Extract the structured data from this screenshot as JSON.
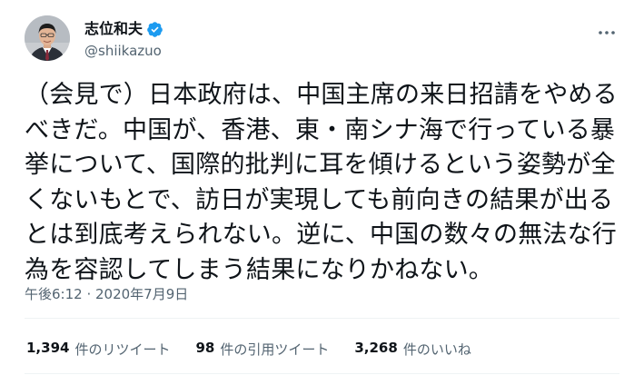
{
  "author": {
    "display_name": "志位和夫",
    "handle": "@shiikazuo",
    "verified": true,
    "verified_color": "#1d9bf0"
  },
  "tweet": {
    "text": "（会見で）日本政府は、中国主席の来日招請をやめる\nべきだ。中国が、香港、東・南シナ海で行っている暴\n挙について、国際的批判に耳を傾けるという姿勢が全\nくないもとで、訪日が実現しても前向きの結果が出る\nとは到底考えられない。逆に、中国の数々の無法な行\n為を容認してしまう結果になりかねない。",
    "timestamp": "午後6:12 · 2020年7月9日"
  },
  "stats": [
    {
      "count": "1,394",
      "label": "件のリツイート"
    },
    {
      "count": "98",
      "label": "件の引用ツイート"
    },
    {
      "count": "3,268",
      "label": "件のいいね"
    }
  ],
  "icons": {
    "avatar": "avatar-portrait",
    "verified": "verified-badge-icon",
    "more": "more-options-icon"
  },
  "colors": {
    "text_primary": "#0f1419",
    "text_secondary": "#536471",
    "divider": "#eff3f4"
  }
}
